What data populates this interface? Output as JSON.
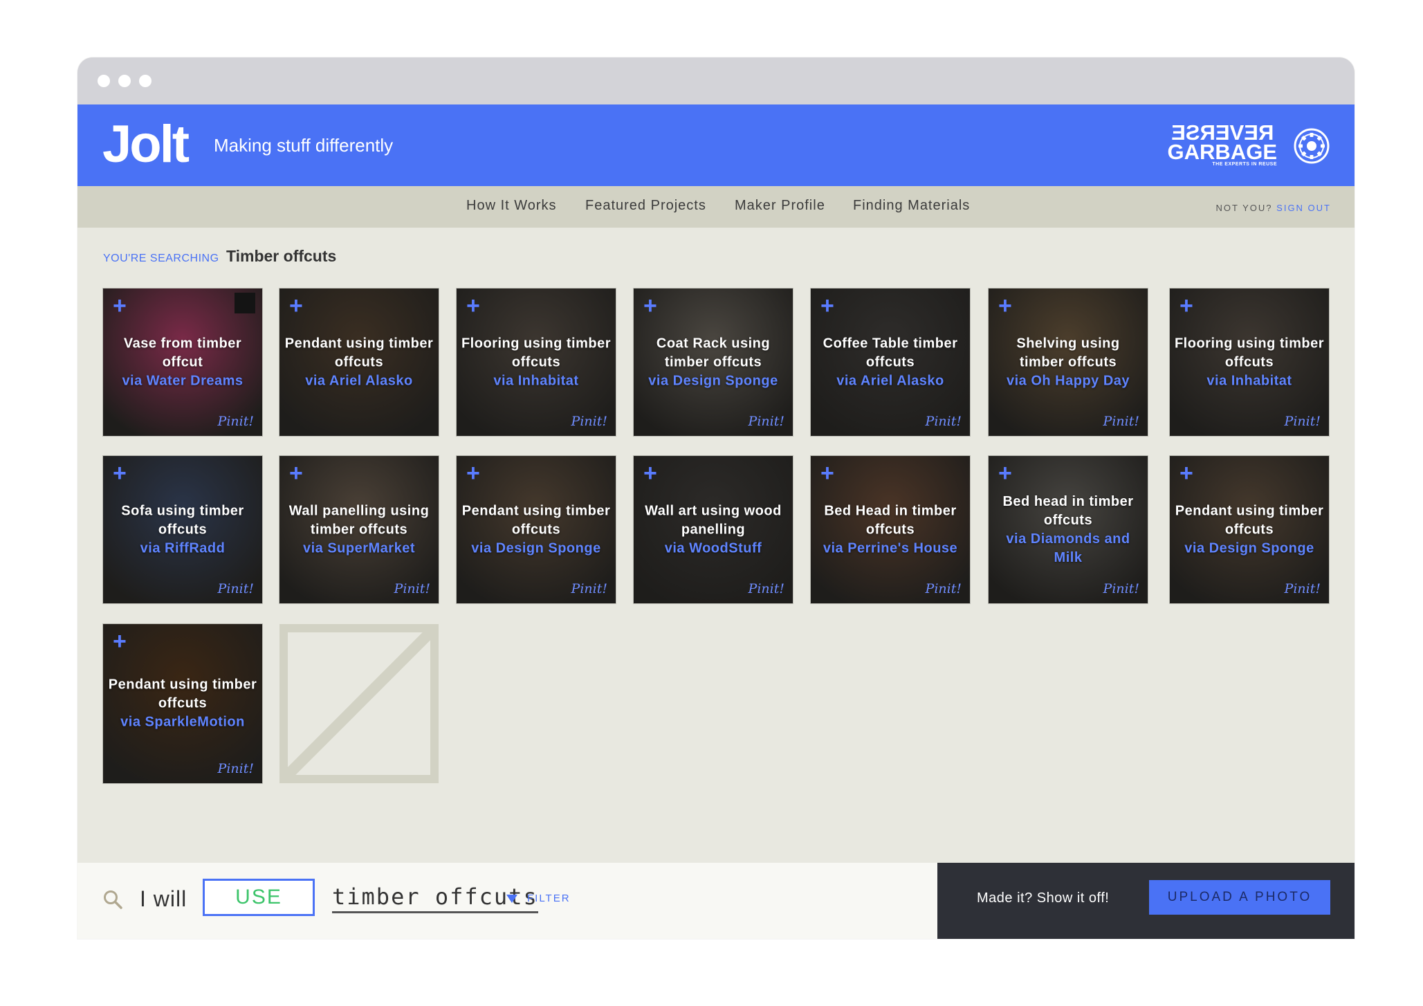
{
  "header": {
    "logo": "Jolt",
    "tagline": "Making stuff differently",
    "partner_top": "REVERSE",
    "partner_bottom": "GARBAGE",
    "partner_sub": "THE EXPERTS IN REUSE"
  },
  "nav": {
    "items": [
      {
        "label": "How It Works"
      },
      {
        "label": "Featured Projects"
      },
      {
        "label": "Maker Profile"
      },
      {
        "label": "Finding Materials"
      }
    ],
    "not_you": "NOT YOU?",
    "sign_out": "SIGN OUT"
  },
  "search": {
    "prefix": "YOU'RE SEARCHING",
    "term": "Timber offcuts"
  },
  "tiles": [
    {
      "title": "Vase from timber offcut",
      "source": "via Water Dreams",
      "pin": "Pinit!",
      "bg": "#7a2a48"
    },
    {
      "title": "Pendant using timber offcuts",
      "source": "via Ariel Alasko",
      "pin": "Pinit!",
      "bg": "#3a2e22"
    },
    {
      "title": "Flooring using timber offcuts",
      "source": "via Inhabitat",
      "pin": "Pinit!",
      "bg": "#3c3630"
    },
    {
      "title": "Coat Rack using timber offcuts",
      "source": "via Design Sponge",
      "pin": "Pinit!",
      "bg": "#4a4640"
    },
    {
      "title": "Coffee Table timber offcuts",
      "source": "via Ariel Alasko",
      "pin": "Pinit!",
      "bg": "#2e2c2a"
    },
    {
      "title": "Shelving using timber offcuts",
      "source": "via Oh Happy Day",
      "pin": "Pinit!",
      "bg": "#4c3e2c"
    },
    {
      "title": "Flooring using timber offcuts",
      "source": "via Inhabitat",
      "pin": "Pinit!",
      "bg": "#3c3630"
    },
    {
      "title": "Sofa using timber offcuts",
      "source": "via RiffRadd",
      "pin": "Pinit!",
      "bg": "#2a3448"
    },
    {
      "title": "Wall panelling using timber offcuts",
      "source": "via SuperMarket",
      "pin": "Pinit!",
      "bg": "#4a4036"
    },
    {
      "title": "Pendant using timber offcuts",
      "source": "via Design Sponge",
      "pin": "Pinit!",
      "bg": "#44382c"
    },
    {
      "title": "Wall art using wood panelling",
      "source": "via WoodStuff",
      "pin": "Pinit!",
      "bg": "#2c2a28"
    },
    {
      "title": "Bed Head in timber offcuts",
      "source": "via Perrine's House",
      "pin": "Pinit!",
      "bg": "#4a3426"
    },
    {
      "title": "Bed head in timber offcuts",
      "source": "via Diamonds and Milk",
      "pin": "Pinit!",
      "bg": "#464440"
    },
    {
      "title": "Pendant using timber offcuts",
      "source": "via Design Sponge",
      "pin": "Pinit!",
      "bg": "#44382c"
    },
    {
      "title": "Pendant using timber offcuts",
      "source": "via SparkleMotion",
      "pin": "Pinit!",
      "bg": "#3a2614"
    }
  ],
  "bottom": {
    "i_will": "I will",
    "verb": "USE",
    "material": "timber offcuts",
    "filter": "FILTER",
    "upload_prompt": "Made it? Show it off!",
    "upload_button": "UPLOAD A PHOTO"
  },
  "colors": {
    "accent": "#4a72f5",
    "verb_green": "#3cc46a",
    "dark_bar": "#2e3037",
    "background": "#e8e8e0"
  }
}
